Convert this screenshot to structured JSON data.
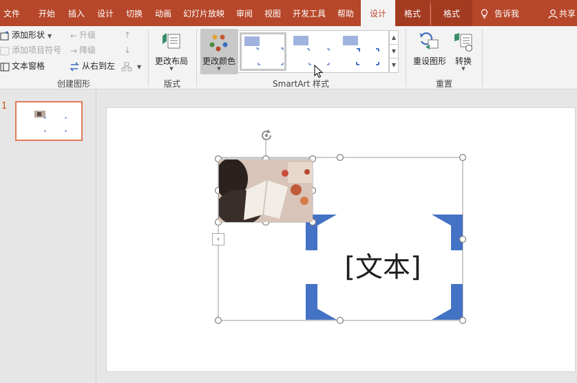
{
  "tabs": [
    {
      "label": "文件"
    },
    {
      "label": "开始"
    },
    {
      "label": "插入"
    },
    {
      "label": "设计"
    },
    {
      "label": "切换"
    },
    {
      "label": "动画"
    },
    {
      "label": "幻灯片放映"
    },
    {
      "label": "审阅"
    },
    {
      "label": "视图"
    },
    {
      "label": "开发工具"
    },
    {
      "label": "帮助"
    },
    {
      "label": "设计"
    },
    {
      "label": "格式"
    },
    {
      "label": "格式"
    }
  ],
  "tell_me": "告诉我",
  "share": "共享",
  "ribbon": {
    "create_graphic": {
      "add_shape": "添加形状",
      "add_bullet": "添加项目符号",
      "text_pane": "文本窗格",
      "promote": "升级",
      "demote": "降级",
      "right_to_left": "从右到左",
      "label": "创建图形"
    },
    "layouts": {
      "change_layout": "更改布局",
      "label": "版式"
    },
    "styles": {
      "change_colors": "更改颜色",
      "label": "SmartArt 样式"
    },
    "reset": {
      "reset_graphic": "重设图形",
      "convert": "转换",
      "label": "重置"
    }
  },
  "slides": {
    "current_number": "1"
  },
  "canvas": {
    "placeholder_text": "[文本]"
  },
  "colors": {
    "accent": "#b7472a",
    "smartart_blue": "#4472c4"
  },
  "icons": [
    "lightbulb-icon",
    "user-icon",
    "rotate-icon",
    "chevron-left-icon",
    "cursor-icon"
  ]
}
